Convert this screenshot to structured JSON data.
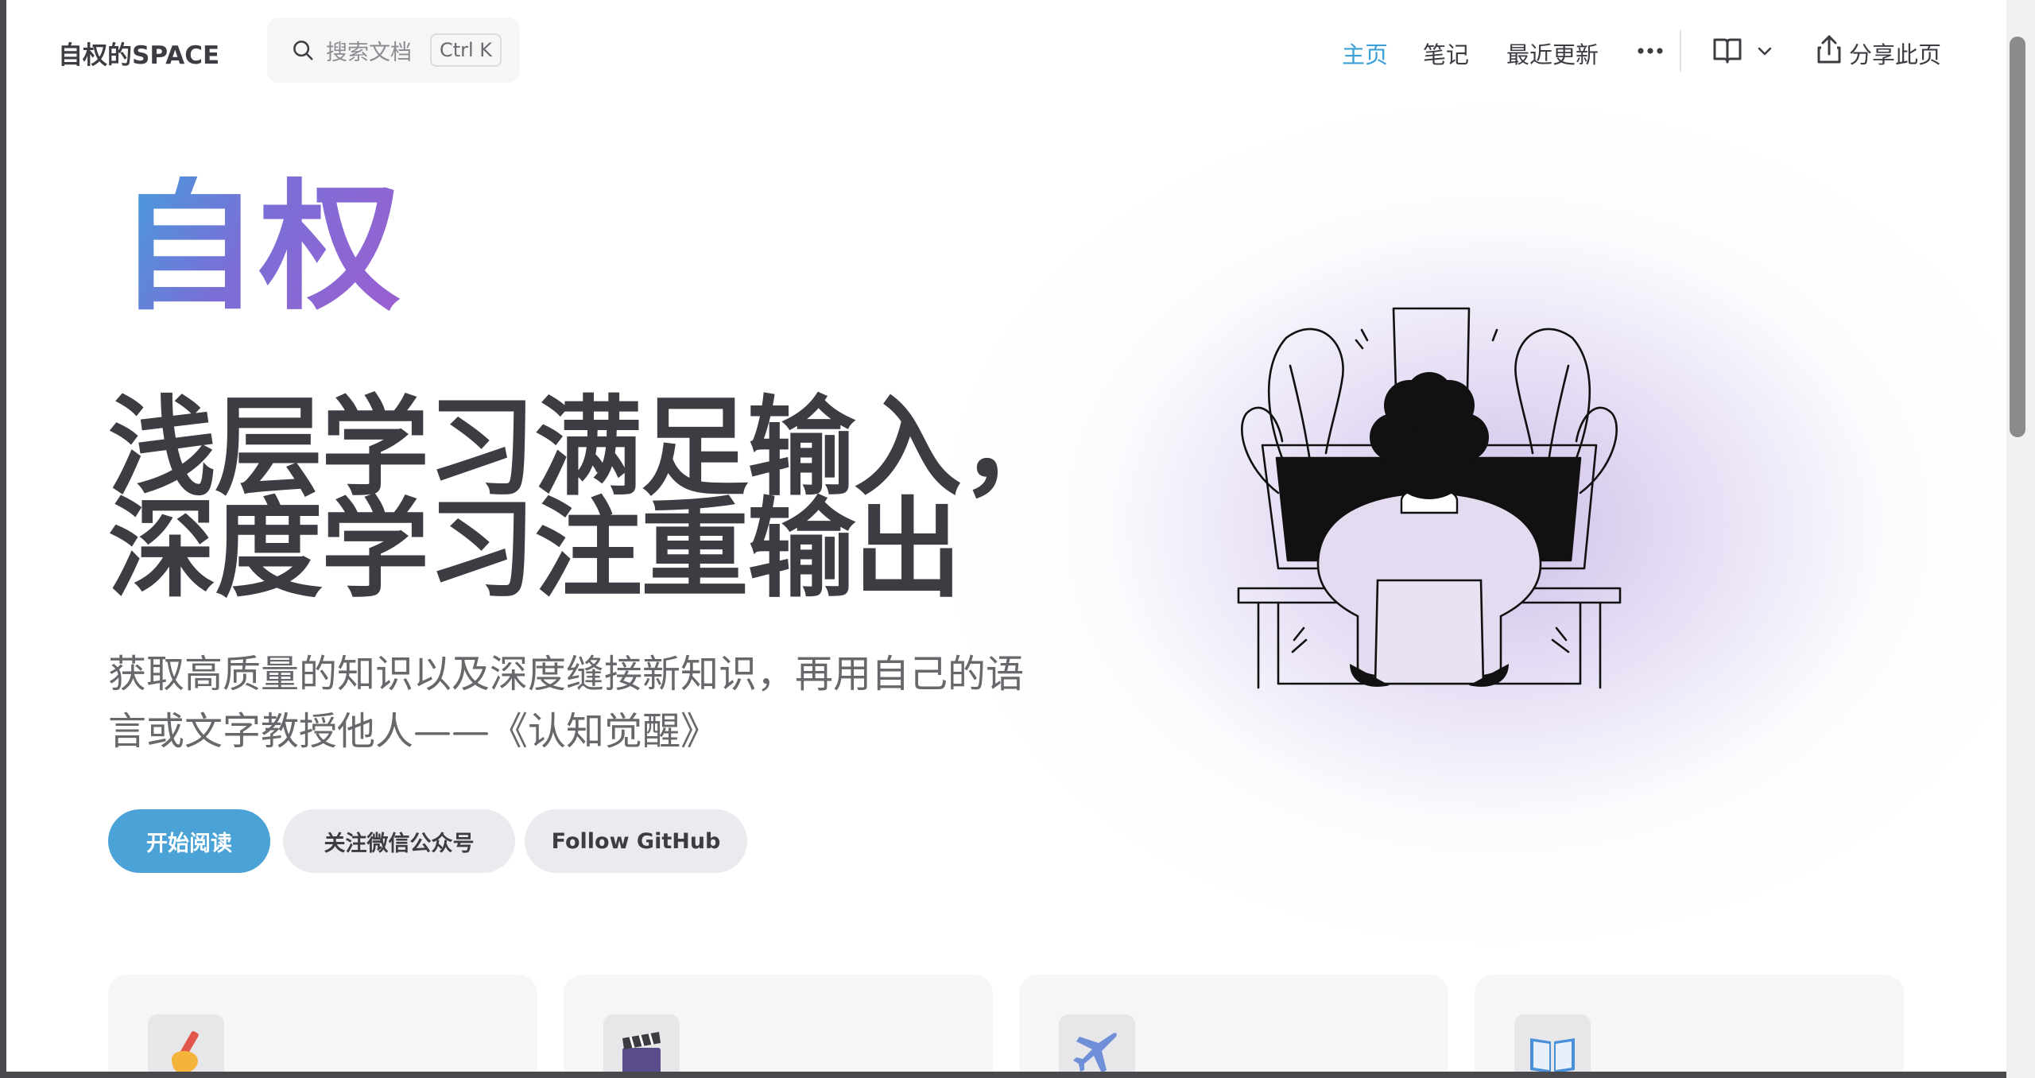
{
  "site": {
    "title": "自权的SPACE"
  },
  "search": {
    "placeholder": "搜索文档",
    "shortcut": "Ctrl K",
    "icon": "search-icon"
  },
  "nav": {
    "links": [
      {
        "label": "主页",
        "active": true
      },
      {
        "label": "笔记",
        "active": false
      },
      {
        "label": "最近更新",
        "active": false
      }
    ],
    "more_icon": "more-dots-icon",
    "book_icon": "book-icon",
    "share_label": "分享此页"
  },
  "hero": {
    "name": "自权",
    "headline_line1": "浅层学习满足输入，",
    "headline_line2": "深度学习注重输出",
    "tagline": "获取高质量的知识以及深度缝接新知识，再用自己的语言或文字教授他人——《认知觉醒》",
    "buttons": {
      "primary": "开始阅读",
      "wechat": "关注微信公众号",
      "github": "Follow GitHub"
    }
  },
  "features": {
    "icons": [
      "writing-hand-icon",
      "clapper-board-icon",
      "airplane-icon",
      "open-book-icon"
    ]
  },
  "colors": {
    "accent": "#3a9fd6",
    "primary_button": "#4ba2d6",
    "text": "#3c3c43",
    "muted": "#67676c"
  }
}
